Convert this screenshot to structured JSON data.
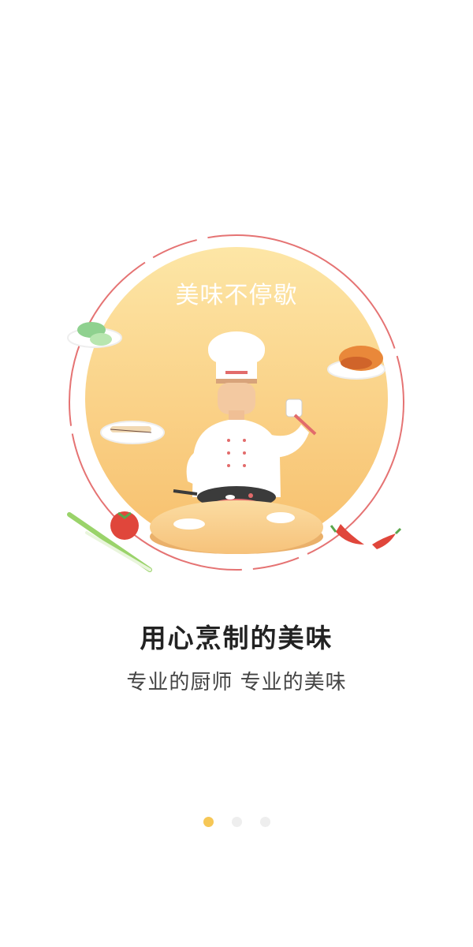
{
  "illustration": {
    "badge_text": "美味不停歇"
  },
  "content": {
    "title": "用心烹制的美味",
    "subtitle": "专业的厨师 专业的美味"
  },
  "pager": {
    "total": 3,
    "active_index": 0
  },
  "colors": {
    "accent": "#f6c756",
    "circle_light": "#fde6a6",
    "circle_dark": "#f7bf6c",
    "ring": "#e57373",
    "title": "#222222",
    "subtitle": "#444444",
    "dot_inactive": "#eeeeee"
  }
}
